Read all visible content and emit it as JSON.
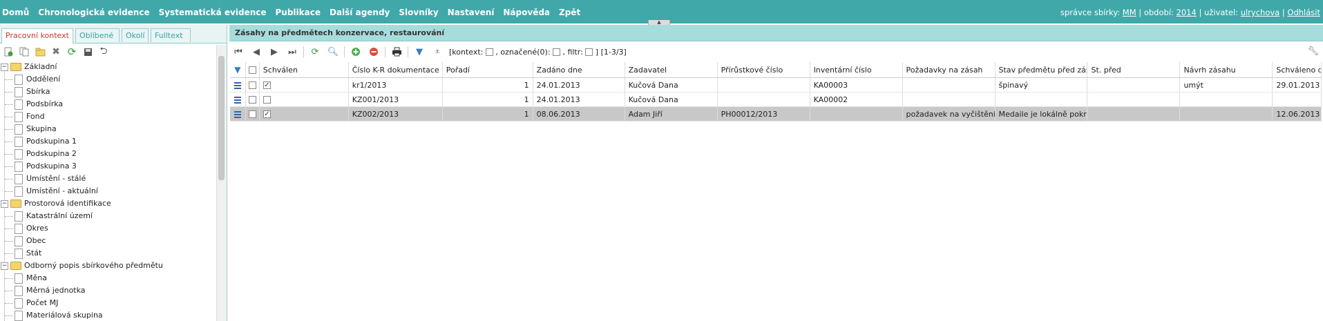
{
  "topbar": {
    "menu": [
      "Domů",
      "Chronologická evidence",
      "Systematická evidence",
      "Publikace",
      "Další agendy",
      "Slovníky",
      "Nastavení",
      "Nápověda",
      "Zpět"
    ],
    "user": {
      "admin_prefix": "správce sbírky:",
      "admin": "MM",
      "period_prefix": "období:",
      "period": "2014",
      "user_prefix": "uživatel:",
      "user": "ulrychova",
      "logout": "Odhlásit"
    }
  },
  "left": {
    "tabs": [
      "Pracovní kontext",
      "Oblíbené",
      "Okolí",
      "Fulltext"
    ],
    "toolbar_icons": [
      "add-node-icon",
      "copy-node-icon",
      "folder-icon",
      "delete-icon",
      "refresh-icon",
      "save-icon",
      "undo-icon"
    ],
    "tree": [
      {
        "label": "Základní",
        "type": "folder",
        "level": 0
      },
      {
        "label": "Oddělení",
        "type": "leaf",
        "level": 1
      },
      {
        "label": "Sbírka",
        "type": "leaf",
        "level": 1
      },
      {
        "label": "Podsbírka",
        "type": "leaf",
        "level": 1
      },
      {
        "label": "Fond",
        "type": "leaf",
        "level": 1
      },
      {
        "label": "Skupina",
        "type": "leaf",
        "level": 1
      },
      {
        "label": "Podskupina 1",
        "type": "leaf",
        "level": 1
      },
      {
        "label": "Podskupina 2",
        "type": "leaf",
        "level": 1
      },
      {
        "label": "Podskupina 3",
        "type": "leaf",
        "level": 1
      },
      {
        "label": "Umístění - stálé",
        "type": "leaf",
        "level": 1
      },
      {
        "label": "Umístění - aktuální",
        "type": "leaf",
        "level": 1
      },
      {
        "label": "Prostorová identifikace",
        "type": "folder",
        "level": 0
      },
      {
        "label": "Katastrální území",
        "type": "leaf",
        "level": 1
      },
      {
        "label": "Okres",
        "type": "leaf",
        "level": 1
      },
      {
        "label": "Obec",
        "type": "leaf",
        "level": 1
      },
      {
        "label": "Stát",
        "type": "leaf",
        "level": 1
      },
      {
        "label": "Odborný popis sbírkového předmětu",
        "type": "folder",
        "level": 0
      },
      {
        "label": "Měna",
        "type": "leaf",
        "level": 1
      },
      {
        "label": "Měrná jednotka",
        "type": "leaf",
        "level": 1
      },
      {
        "label": "Počet MJ",
        "type": "leaf",
        "level": 1
      },
      {
        "label": "Materiálová skupina",
        "type": "leaf",
        "level": 1
      }
    ]
  },
  "right": {
    "title": "Zásahy na předmětech konzervace, restaurování",
    "context": {
      "kontext_label": "[kontext:",
      "oznacene_label": ", označené(0):",
      "filtr_label": ", filtr:",
      "range": "] [1-3/3]"
    },
    "columns": [
      "Schválen",
      "Číslo K-R dokumentace",
      "Pořadí",
      "Zadáno dne",
      "Zadavatel",
      "Přírůstkové číslo",
      "Inventární číslo",
      "Požadavky na zásah",
      "Stav předmětu před zásahem",
      "St. před",
      "Návrh zásahu",
      "Schváleno dne"
    ],
    "rows": [
      {
        "approved": true,
        "cells": [
          "kr1/2013",
          "1",
          "24.01.2013",
          "Kučová Dana",
          "",
          "KA00003",
          "",
          "špinavý",
          "",
          "umýt",
          "29.01.2013"
        ],
        "selected": false
      },
      {
        "approved": false,
        "cells": [
          "KZ001/2013",
          "1",
          "24.01.2013",
          "Kučová Dana",
          "",
          "KA00002",
          "",
          "",
          "",
          "",
          ""
        ],
        "selected": false
      },
      {
        "approved": true,
        "cells": [
          "KZ002/2013",
          "1",
          "08.06.2013",
          "Adam Jiří",
          "PH00012/2013",
          "",
          "požadavek na vyčištění",
          "Medaile je lokálně pokryta",
          "",
          "",
          "12.06.2013"
        ],
        "selected": true
      }
    ]
  },
  "colors": {
    "topbar": "#40a8a9",
    "panel_header": "#a7dcdc",
    "selected_row": "#c8c8c8",
    "active_tab_text": "#c0392b"
  }
}
